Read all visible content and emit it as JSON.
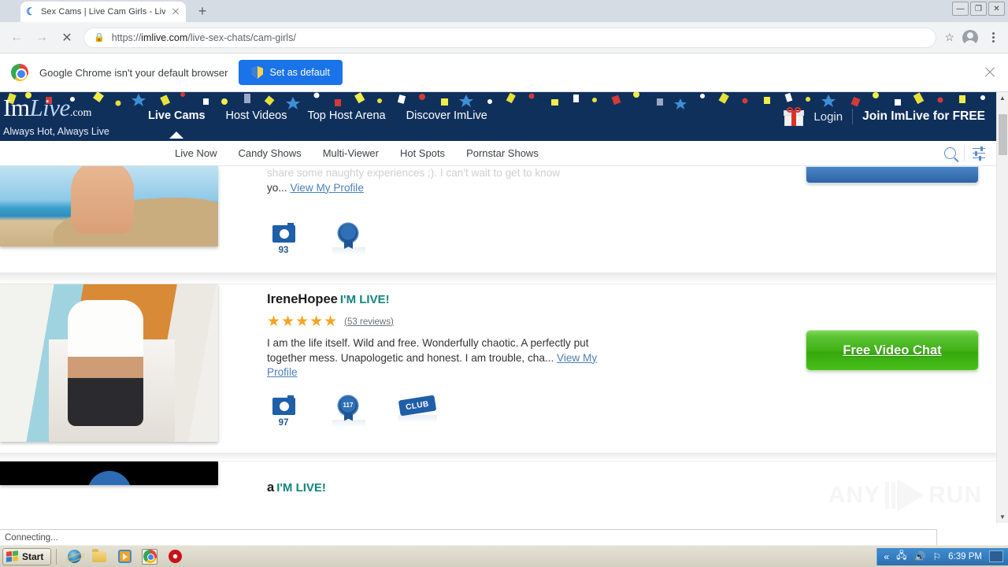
{
  "browser": {
    "tab": {
      "title": "Sex Cams | Live Cam Girls - Live Sex",
      "favicon": "loading-spinner-icon",
      "close": "×"
    },
    "newtab_label": "+",
    "window_controls": {
      "minimize": "—",
      "maximize": "❐",
      "close": "✕"
    },
    "nav": {
      "back": "←",
      "forward": "→",
      "stop": "✕"
    },
    "omnibox": {
      "lock_icon": "lock-icon",
      "url_scheme": "https://",
      "url_domain": "imlive.com",
      "url_path": "/live-sex-chats/cam-girls/",
      "bookmark_icon": "star-icon",
      "profile_icon": "profile-avatar-icon",
      "menu_icon": "kebab-menu-icon"
    },
    "infobar": {
      "message": "Google Chrome isn't your default browser",
      "button_label": "Set as default",
      "close_label": "×"
    },
    "status": "Connecting..."
  },
  "site": {
    "logo": {
      "im": "Im",
      "live": "Live",
      "com": ".com",
      "tagline": "Always Hot, Always Live"
    },
    "mainnav": [
      {
        "label": "Live Cams",
        "active": true
      },
      {
        "label": "Host Videos",
        "active": false
      },
      {
        "label": "Top Host Arena",
        "active": false
      },
      {
        "label": "Discover ImLive",
        "active": false
      }
    ],
    "header_right": {
      "gift_icon": "gift-box-icon",
      "login": "Login",
      "join": "Join ImLive for FREE"
    },
    "subnav": [
      {
        "label": "Live Now"
      },
      {
        "label": "Candy Shows"
      },
      {
        "label": "Multi-Viewer"
      },
      {
        "label": "Hot Spots"
      },
      {
        "label": "Pornstar Shows"
      }
    ],
    "subnav_right": {
      "search_icon": "search-icon",
      "filter_icon": "filter-sliders-icon"
    }
  },
  "listings": [
    {
      "name": "",
      "live_flag": "",
      "reviews": "",
      "desc_tail": "yo...",
      "profile_link": "View My Profile",
      "desc_clipped": "share some naughty experiences ;). I can't wait to get to know",
      "photos_count": "93",
      "badges": [
        "camera-photos-badge",
        "trophy-award-badge"
      ],
      "cta": ""
    },
    {
      "name": "IreneHopee",
      "live_flag": "I'M LIVE!",
      "stars": "★★★★★",
      "reviews": "(53 reviews)",
      "desc": "I am the life itself. Wild and free. Wonderfully chaotic. A perfectly put together mess. Unapologetic and honest. I am trouble, cha...",
      "profile_link": "View My Profile",
      "photos_count": "97",
      "club_label": "CLUB",
      "award_number": "117",
      "cta": "Free Video Chat"
    },
    {
      "name": "a",
      "live_flag": "I'M LIVE!",
      "play_icon": "play-button-icon"
    }
  ],
  "watermark": {
    "text_left": "ANY",
    "text_right": "RUN"
  },
  "taskbar": {
    "start_label": "Start",
    "quicklaunch": [
      {
        "icon": "internet-explorer-icon",
        "selected": false
      },
      {
        "icon": "file-explorer-icon",
        "selected": false
      },
      {
        "icon": "media-player-icon",
        "selected": false
      },
      {
        "icon": "google-chrome-icon",
        "selected": true
      },
      {
        "icon": "opera-browser-icon",
        "selected": false
      }
    ],
    "tray": {
      "expand": "«",
      "network_icon": "network-icon",
      "volume_icon": "volume-icon",
      "flag_icon": "security-flag-icon",
      "time": "6:39 PM"
    }
  },
  "colors": {
    "site_navy": "#10305c",
    "cta_green": "#3fb014",
    "live_teal": "#12857e",
    "link_blue": "#4b7fba",
    "star_gold": "#f4a522",
    "chrome_blue": "#1a73e8"
  }
}
